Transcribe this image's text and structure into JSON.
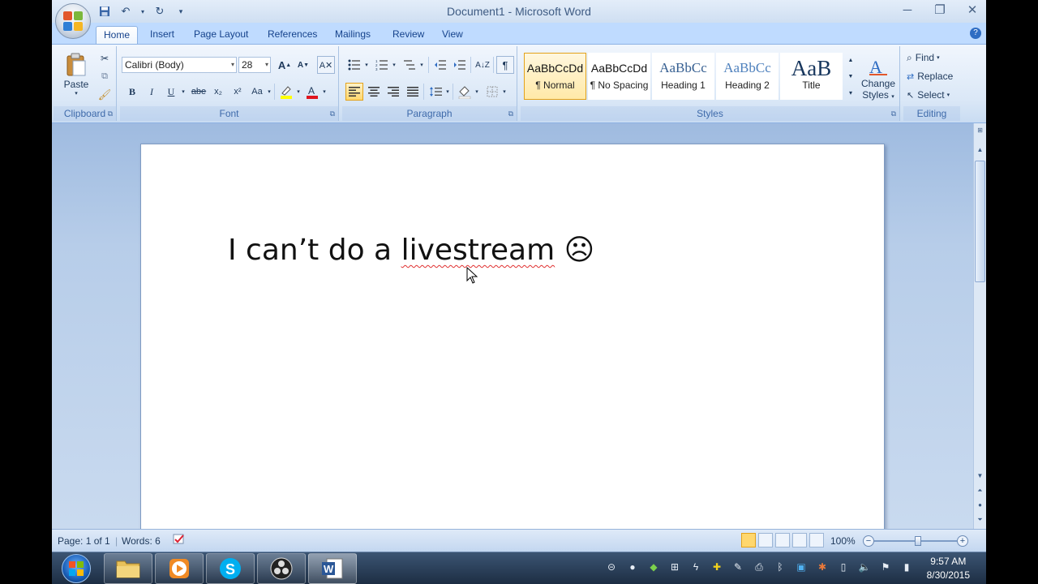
{
  "window": {
    "title": "Document1 - Microsoft Word",
    "minimize_glyph": "─",
    "maximize_glyph": "❐",
    "close_glyph": "✕"
  },
  "qat": {
    "save_icon": "save-icon",
    "undo_icon": "undo-icon",
    "redo_icon": "redo-icon",
    "customize_icon": "customize-icon"
  },
  "tabs": [
    {
      "label": "Home",
      "active": true
    },
    {
      "label": "Insert"
    },
    {
      "label": "Page Layout"
    },
    {
      "label": "References"
    },
    {
      "label": "Mailings"
    },
    {
      "label": "Review"
    },
    {
      "label": "View"
    }
  ],
  "help_glyph": "?",
  "clipboard": {
    "paste_label": "Paste",
    "group_label": "Clipboard"
  },
  "font": {
    "font_name": "Calibri (Body)",
    "font_size": "28",
    "group_label": "Font",
    "bold": "B",
    "italic": "I",
    "underline": "U",
    "strike": "abe",
    "subscript": "x₂",
    "superscript": "x²",
    "change_case": "Aa",
    "grow": "A",
    "shrink": "A"
  },
  "paragraph": {
    "group_label": "Paragraph",
    "pilcrow": "¶"
  },
  "styles": {
    "group_label": "Styles",
    "items": [
      {
        "sample": "AaBbCcDd",
        "name": "¶ Normal",
        "selected": true
      },
      {
        "sample": "AaBbCcDd",
        "name": "¶ No Spacing"
      },
      {
        "sample": "AaBbCc",
        "name": "Heading 1"
      },
      {
        "sample": "AaBbCc",
        "name": "Heading 2"
      },
      {
        "sample": "AaB",
        "name": "Title"
      }
    ],
    "change_styles_line1": "Change",
    "change_styles_line2": "Styles"
  },
  "editing": {
    "group_label": "Editing",
    "find": "Find",
    "replace": "Replace",
    "select": "Select"
  },
  "document": {
    "text_before": "I can’t do a ",
    "text_misspelled": "livestream",
    "text_after": " ☹"
  },
  "status": {
    "page": "Page: 1 of 1",
    "words": "Words: 6",
    "zoom": "100%"
  },
  "taskbar": {
    "time": "9:57 AM",
    "date": "8/30/2015"
  }
}
